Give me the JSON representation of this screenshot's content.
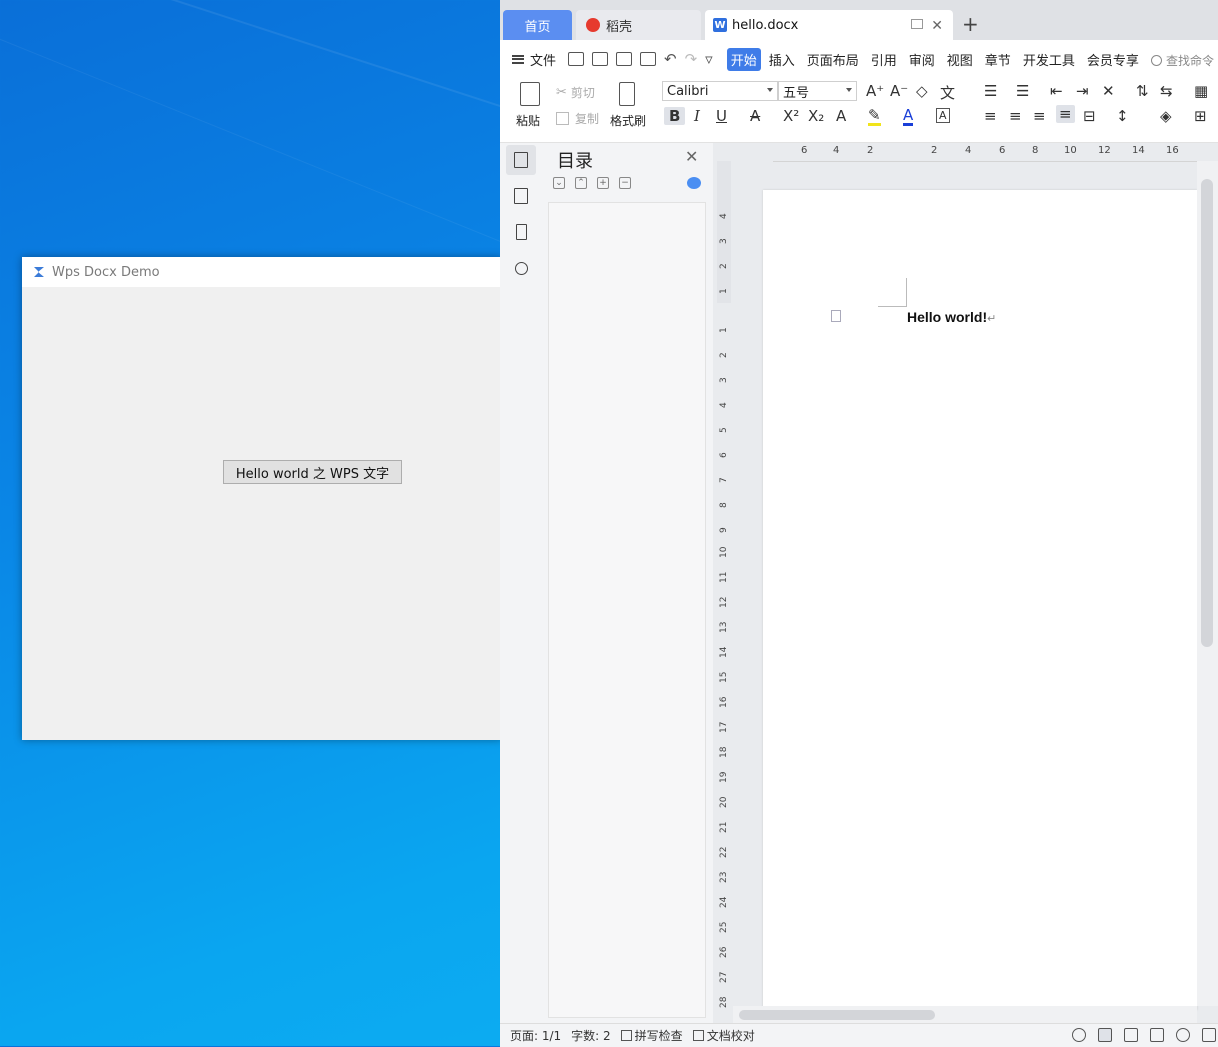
{
  "demo_window": {
    "title": "Wps Docx Demo",
    "button_label": "Hello world 之 WPS 文字"
  },
  "wps": {
    "tabs": {
      "home": "首页",
      "daoke": "稻壳",
      "document": "hello.docx"
    },
    "menu": {
      "file": "文件",
      "tabs": [
        "开始",
        "插入",
        "页面布局",
        "引用",
        "审阅",
        "视图",
        "章节",
        "开发工具",
        "会员专享"
      ],
      "search": "查找命令"
    },
    "ribbon": {
      "paste": "粘贴",
      "cut": "剪切",
      "copy": "复制",
      "format_painter": "格式刷",
      "font_name": "Calibri",
      "font_size": "五号"
    },
    "toc": {
      "title": "目录"
    },
    "ruler": {
      "h": [
        "6",
        "4",
        "2",
        "2",
        "4",
        "6",
        "8",
        "10",
        "12",
        "14",
        "16"
      ],
      "v_top": [
        "4",
        "3",
        "2",
        "1"
      ],
      "v": [
        "1",
        "2",
        "3",
        "4",
        "5",
        "6",
        "7",
        "8",
        "9",
        "10",
        "11",
        "12",
        "13",
        "14",
        "15",
        "16",
        "17",
        "18",
        "19",
        "20",
        "21",
        "22",
        "23",
        "24",
        "25",
        "26",
        "27",
        "28"
      ]
    },
    "document": {
      "text": "Hello world!",
      "para_mark": "↵"
    },
    "status": {
      "page": "页面: 1/1",
      "word_count": "字数: 2",
      "spell_check": "拼写检查",
      "doc_check": "文档校对"
    }
  }
}
